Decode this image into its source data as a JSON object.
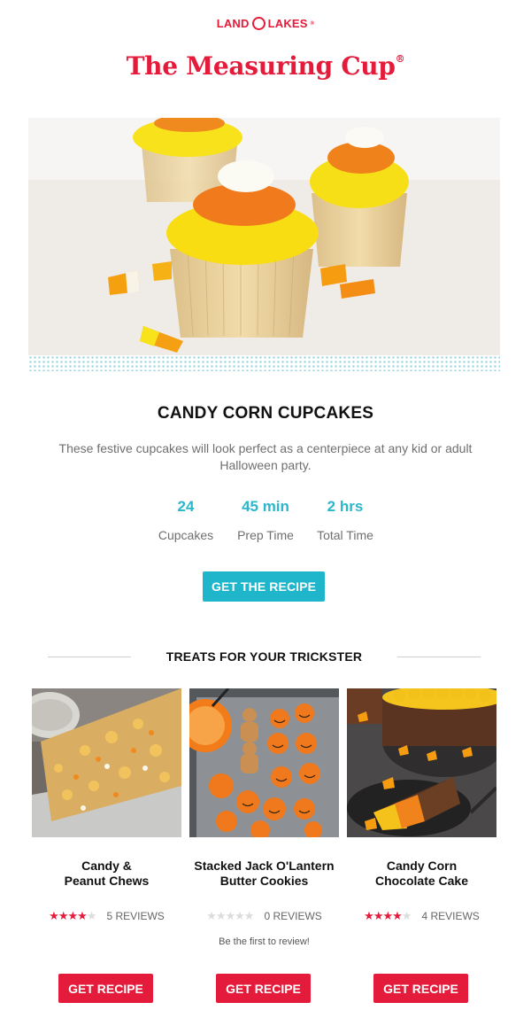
{
  "brand": {
    "logo_left": "LAND",
    "logo_right": "LAKES",
    "logo_mark": "®",
    "masthead": "The Measuring Cup",
    "masthead_mark": "®"
  },
  "hero": {
    "image": "candy-corn-cupcakes-photo"
  },
  "recipe": {
    "title": "CANDY CORN CUPCAKES",
    "description": "These festive cupcakes will look perfect as a centerpiece at any kid or adult Halloween party.",
    "stats": [
      {
        "value": "24",
        "label": "Cupcakes"
      },
      {
        "value": "45 min",
        "label": "Prep Time"
      },
      {
        "value": "2 hrs",
        "label": "Total Time"
      }
    ],
    "cta": "GET THE RECIPE"
  },
  "section": {
    "title": "TREATS FOR YOUR TRICKSTER"
  },
  "cards": [
    {
      "title_line1": "Candy &",
      "title_line2": "Peanut Chews",
      "rating": 4,
      "reviews": "5 REVIEWS",
      "note": "",
      "button": "GET RECIPE",
      "image": "candy-peanut-chews-photo"
    },
    {
      "title_line1": "Stacked Jack O'Lantern",
      "title_line2": "Butter Cookies",
      "rating": 0,
      "reviews": "0 REVIEWS",
      "note": "Be the first to review!",
      "button": "GET RECIPE",
      "image": "jack-o-lantern-cookies-photo"
    },
    {
      "title_line1": "Candy Corn",
      "title_line2": "Chocolate Cake",
      "rating": 4,
      "reviews": "4 REVIEWS",
      "note": "",
      "button": "GET RECIPE",
      "image": "candy-corn-chocolate-cake-photo"
    }
  ],
  "colors": {
    "brand_red": "#e41b3a",
    "accent_teal": "#1fb6cc",
    "stat_teal": "#2ab7cb"
  }
}
